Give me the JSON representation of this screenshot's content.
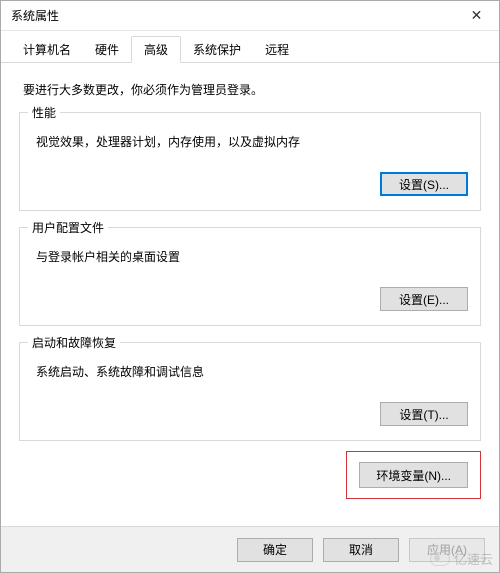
{
  "window": {
    "title": "系统属性"
  },
  "tabs": {
    "items": [
      {
        "label": "计算机名"
      },
      {
        "label": "硬件"
      },
      {
        "label": "高级"
      },
      {
        "label": "系统保护"
      },
      {
        "label": "远程"
      }
    ],
    "active_index": 2
  },
  "intro": "要进行大多数更改，你必须作为管理员登录。",
  "groups": {
    "performance": {
      "title": "性能",
      "desc": "视觉效果，处理器计划，内存使用，以及虚拟内存",
      "button": "设置(S)..."
    },
    "profiles": {
      "title": "用户配置文件",
      "desc": "与登录帐户相关的桌面设置",
      "button": "设置(E)..."
    },
    "startup": {
      "title": "启动和故障恢复",
      "desc": "系统启动、系统故障和调试信息",
      "button": "设置(T)..."
    }
  },
  "env_button": "环境变量(N)...",
  "bottom": {
    "ok": "确定",
    "cancel": "取消",
    "apply": "应用(A)"
  },
  "watermark": "亿速云"
}
